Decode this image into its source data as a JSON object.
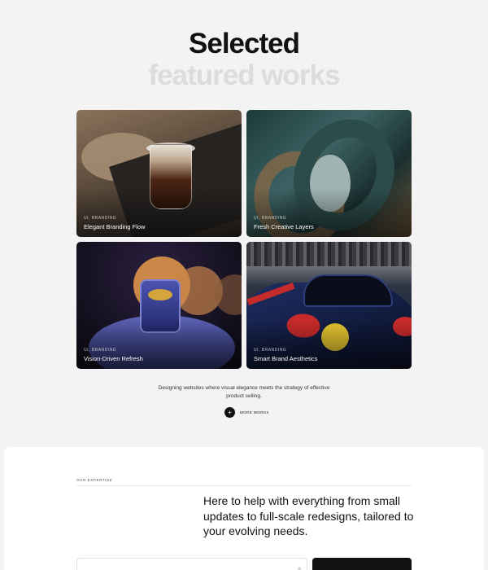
{
  "hero": {
    "title": "Selected",
    "subtitle": "featured works"
  },
  "works": [
    {
      "tag": "UI, BRANDING",
      "label": "Elegant Branding Flow"
    },
    {
      "tag": "UI, BRANDING",
      "label": "Fresh Creative Layers"
    },
    {
      "tag": "UI, BRANDING",
      "label": "Vision-Driven Refresh"
    },
    {
      "tag": "UI, BRANDING",
      "label": "Smart Brand Aesthetics"
    }
  ],
  "intro": "Designing websites where visual elegance meets the strategy of effective product selling.",
  "more_button": {
    "icon": "+",
    "label": "MORE WORKS"
  },
  "expertise": {
    "eyebrow": "OUR EXPERTISE",
    "statement": "Here to help with everything from small updates to full-scale redesigns, tailored to your evolving needs."
  },
  "icons": {
    "plus": "plus-icon",
    "field": "sparkle-icon"
  },
  "colors": {
    "background": "#f3f3f3",
    "text": "#111111",
    "subtitle": "#dcdcdc",
    "panel": "#ffffff"
  }
}
